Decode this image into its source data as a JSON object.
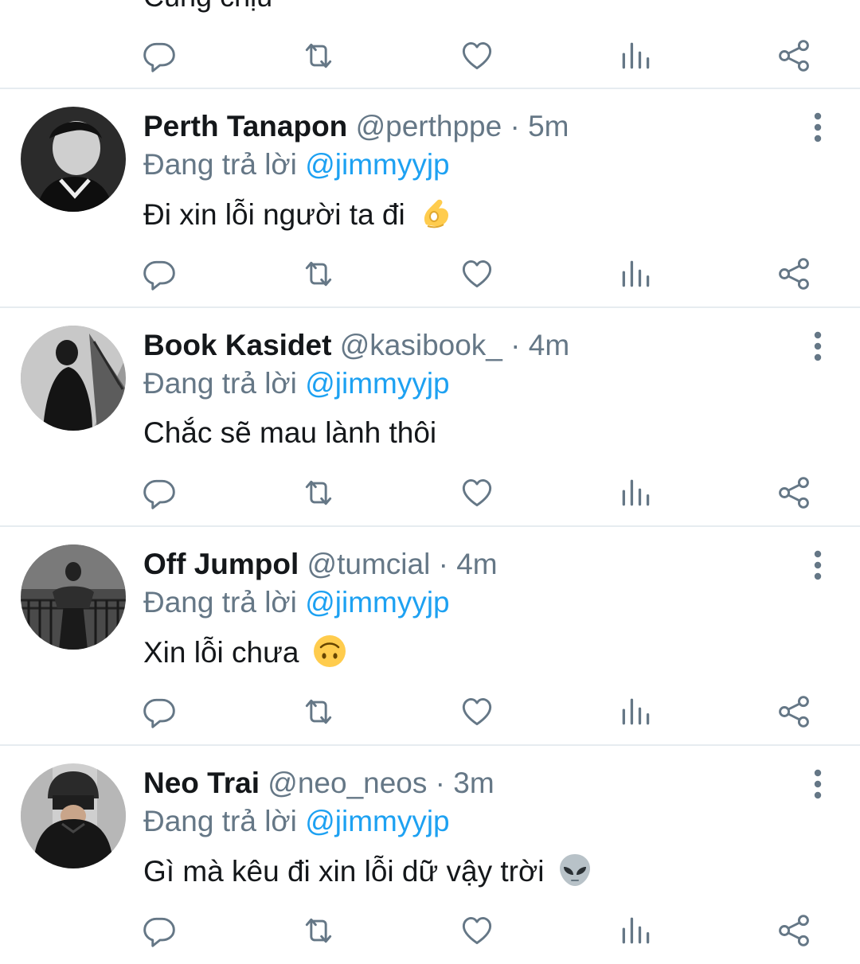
{
  "partial_tweet": {
    "text": "Cũng chịu"
  },
  "reply_prefix": "Đang trả lời",
  "tweets": [
    {
      "name": "Perth Tanapon",
      "handle": "@perthppe",
      "separator": "·",
      "time": "5m",
      "reply_to": "@jimmyyjp",
      "text": "Đi xin lỗi người ta đi",
      "emoji": "pinching-hand"
    },
    {
      "name": "Book Kasidet",
      "handle": "@kasibook_",
      "separator": "·",
      "time": "4m",
      "reply_to": "@jimmyyjp",
      "text": "Chắc sẽ mau lành thôi",
      "emoji": ""
    },
    {
      "name": "Off Jumpol",
      "handle": "@tumcial",
      "separator": "·",
      "time": "4m",
      "reply_to": "@jimmyyjp",
      "text": "Xin lỗi chưa",
      "emoji": "upside-down-face"
    },
    {
      "name": "Neo Trai",
      "handle": "@neo_neos",
      "separator": "·",
      "time": "3m",
      "reply_to": "@jimmyyjp",
      "text": "Gì mà kêu đi xin lỗi dữ vậy trời",
      "emoji": "alien"
    }
  ],
  "actions": [
    "reply-icon",
    "retweet-icon",
    "like-icon",
    "analytics-icon",
    "share-icon"
  ],
  "colors": {
    "icon": "#657786",
    "link": "#1da1f2",
    "divider": "#e6ecf0"
  }
}
